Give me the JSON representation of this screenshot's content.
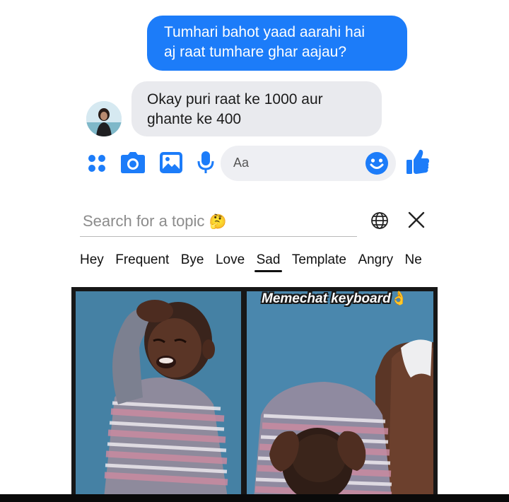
{
  "chat": {
    "sent_message": {
      "lines": [
        "Tumhari bahot yaad aarahi hai",
        "aj raat tumhare ghar aajau?"
      ]
    },
    "received_message": {
      "lines": [
        "Okay puri raat ke 1000 aur",
        "ghante ke 400"
      ]
    }
  },
  "composer": {
    "placeholder": "Aa",
    "icons": [
      "apps-grid-icon",
      "camera-icon",
      "gallery-icon",
      "microphone-icon",
      "emoji-icon",
      "thumbs-up-icon"
    ]
  },
  "keyboard": {
    "search_placeholder": "Search for a topic",
    "search_emoji": "🤔",
    "tabs": [
      "Hey",
      "Frequent",
      "Bye",
      "Love",
      "Sad",
      "Template",
      "Angry",
      "Ne"
    ],
    "active_tab": "Sad",
    "watermark": "Memechat keyboard",
    "watermark_emoji": "👌"
  },
  "colors": {
    "accent": "#1c7cf9",
    "incoming_bubble": "#e9eaee",
    "composer_bg": "#eeeff3"
  }
}
